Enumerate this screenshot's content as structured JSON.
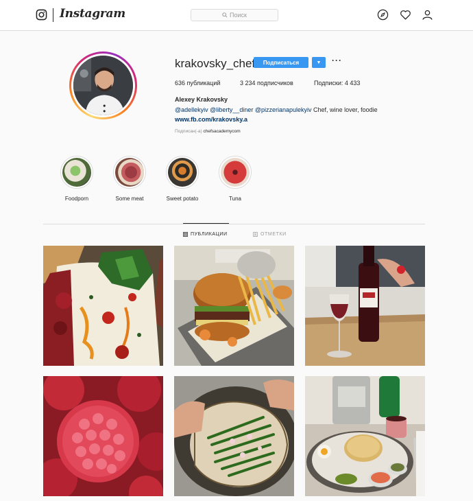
{
  "nav": {
    "brand": "Instagram",
    "search_placeholder": "Поиск"
  },
  "profile": {
    "username": "krakovsky_chef",
    "follow_label": "Подписаться",
    "more_label": "···",
    "stats": {
      "posts": "636 публикаций",
      "followers": "3 234 подписчиков",
      "following": "Подписки: 4 433"
    },
    "full_name": "Alexey Krakovsky",
    "bio": {
      "mention1": "@adellekyiv",
      "mention2": "@liberty__diner",
      "mention3": "@pizzerianapulekyiv",
      "text": " Chef, wine lover, foodie"
    },
    "link": "www.fb.com/krakovsky.a",
    "followed_by_prefix": "Подписан(-а)",
    "followed_by_account": "chefsacademycom"
  },
  "highlights": [
    {
      "label": "Foodporn"
    },
    {
      "label": "Some meat"
    },
    {
      "label": "Sweet potato"
    },
    {
      "label": "Tuna"
    }
  ],
  "tabs": {
    "posts": "ПУБЛИКАЦИИ",
    "tagged": "ОТМЕТКИ"
  },
  "colors": {
    "accent": "#3897f0",
    "link": "#003569",
    "border": "#dbdbdb"
  }
}
